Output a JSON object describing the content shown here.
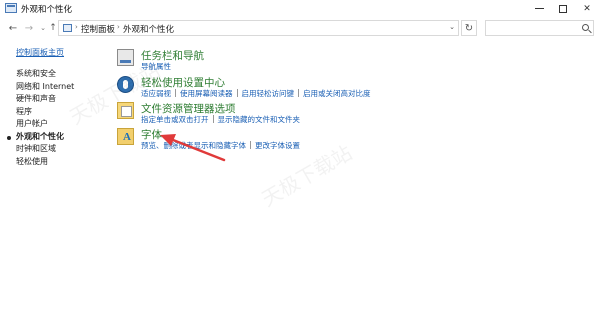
{
  "window": {
    "title": "外观和个性化"
  },
  "address": {
    "crumbs": [
      "控制面板",
      "外观和个性化"
    ],
    "search_placeholder": ""
  },
  "sidebar": {
    "home": "控制面板主页",
    "items": [
      "系统和安全",
      "网络和 Internet",
      "硬件和声音",
      "程序",
      "用户帐户",
      "外观和个性化",
      "时钟和区域",
      "轻松使用"
    ],
    "active_index": 5
  },
  "categories": [
    {
      "title": "任务栏和导航",
      "links": [
        "导航属性"
      ],
      "icon": "taskbar-icon"
    },
    {
      "title": "轻松使用设置中心",
      "links": [
        "适应弱视",
        "使用屏幕阅读器",
        "启用轻松访问键",
        "启用或关闭高对比度"
      ],
      "icon": "ease-of-access-icon"
    },
    {
      "title": "文件资源管理器选项",
      "links": [
        "指定单击或双击打开",
        "显示隐藏的文件和文件夹"
      ],
      "icon": "folder-options-icon"
    },
    {
      "title": "字体",
      "links": [
        "预览、删除或者显示和隐藏字体",
        "更改字体设置"
      ],
      "icon": "fonts-icon"
    }
  ],
  "watermarks": [
    "天极下载站",
    "天极下载站"
  ],
  "colors": {
    "link": "#1a5fb4",
    "category_title": "#2e7d32",
    "arrow": "#e03a3a"
  }
}
